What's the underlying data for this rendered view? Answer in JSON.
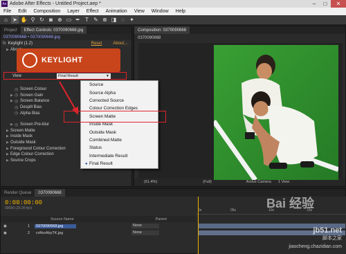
{
  "window": {
    "title": "Adobe After Effects - Untitled Project.aep *",
    "app_icon": "Ae"
  },
  "menu": [
    "File",
    "Edit",
    "Composition",
    "Layer",
    "Effect",
    "Animation",
    "View",
    "Window",
    "Help"
  ],
  "toolbar": {
    "icons": [
      "home-icon",
      "selection-icon",
      "hand-icon",
      "zoom-icon",
      "rotate-icon",
      "camera-icon",
      "pan-behind-icon",
      "mask-icon",
      "pen-icon",
      "text-icon",
      "brush-icon",
      "clone-icon",
      "eraser-icon",
      "roto-icon",
      "puppet-icon"
    ]
  },
  "left_panel": {
    "tabs": [
      "Project",
      "Effect Controls: 0370090668.jpg"
    ],
    "subheader": "0370090668 • 0370090668.jpg",
    "effect": {
      "name": "Keylight (1.2)",
      "reset": "Reset",
      "about": "About..."
    },
    "about_label": "About",
    "logo_text": "KEYLIGHT",
    "view": {
      "label": "View",
      "value": "Final Result"
    },
    "params": [
      "Screen Colour",
      "Screen Gain",
      "Screen Balance",
      "Despill Bias",
      "Alpha Bias",
      "Screen Pre-blur",
      "Screen Matte",
      "Inside Mask",
      "Outside Mask",
      "Foreground Colour Correction",
      "Edge Colour Correction",
      "Source Crops"
    ]
  },
  "dropdown": {
    "items": [
      "Source",
      "Source Alpha",
      "Corrected Source",
      "Colour Correction Edges",
      "Screen Matte",
      "Inside Mask",
      "Outside Mask",
      "Combined Matte",
      "Status",
      "Intermediate Result",
      "Final Result"
    ],
    "selected": "Final Result",
    "highlighted": "Screen Matte"
  },
  "comp_panel": {
    "tab": "Composition: 0370090668",
    "subtab": "0370090668",
    "footer": {
      "zoom": "(61.4%)",
      "resolution": "(Full)",
      "camera": "Active Camera",
      "view": "1 View"
    }
  },
  "timeline": {
    "tabs": [
      "Render Queue",
      "0370090668"
    ],
    "timecode": "0:00:00:00",
    "fps": "00000 (25.00 fps)",
    "columns": {
      "source_name": "Source Name",
      "parent": "Parent"
    },
    "layers": [
      {
        "num": "1",
        "name": "0370090668.jpg",
        "parent": "None"
      },
      {
        "num": "2",
        "name": "crAbvAbyTK.jpg",
        "parent": "None"
      }
    ],
    "ruler": [
      "0s",
      "05s",
      "10s",
      "15s"
    ]
  },
  "watermark": {
    "brand": "Bai 经验",
    "site": "jb51.net",
    "cn": "脚本之家",
    "url": "jiaocheng.chazidian.com"
  },
  "colors": {
    "accent_red": "#e0242c",
    "timecode": "#f0b400",
    "link_orange": "#e2a13c"
  }
}
